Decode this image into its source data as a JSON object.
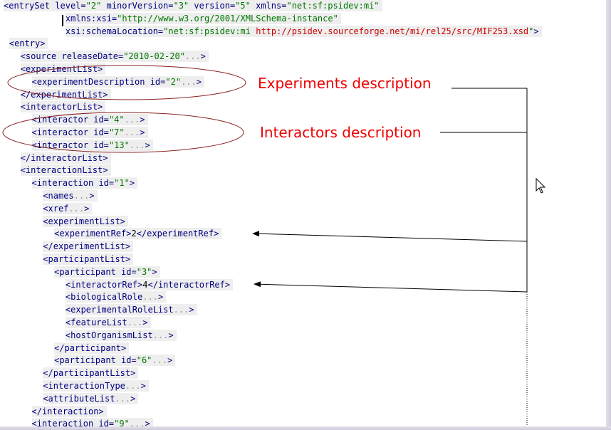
{
  "code_lines": [
    {
      "indent": 0,
      "shaded": true,
      "tokens": [
        {
          "k": "t",
          "s": "<entrySet"
        },
        {
          "k": "x",
          "s": " "
        },
        {
          "k": "a",
          "s": "level="
        },
        {
          "k": "v",
          "s": "\"2\""
        },
        {
          "k": "x",
          "s": " "
        },
        {
          "k": "a",
          "s": "minorVersion="
        },
        {
          "k": "v",
          "s": "\"3\""
        },
        {
          "k": "x",
          "s": " "
        },
        {
          "k": "a",
          "s": "version="
        },
        {
          "k": "v",
          "s": "\"5\""
        },
        {
          "k": "x",
          "s": " "
        },
        {
          "k": "a",
          "s": "xmlns="
        },
        {
          "k": "v",
          "s": "\"net:sf:psidev:mi\""
        }
      ]
    },
    {
      "indent": 11,
      "shaded": true,
      "tokens": [
        {
          "k": "a",
          "s": "xmlns:xsi="
        },
        {
          "k": "v",
          "s": "\"http://www.w3.org/2001/XMLSchema-instance\""
        }
      ]
    },
    {
      "indent": 11,
      "shaded": true,
      "tokens": [
        {
          "k": "a",
          "s": "xsi:schemaLocation="
        },
        {
          "k": "v",
          "s": "\"net:sf:psidev:mi"
        },
        {
          "k": "x",
          "s": " "
        },
        {
          "k": "l",
          "s": "http://psidev.sourceforge.net/mi/rel25/src/MIF253.xsd"
        },
        {
          "k": "v",
          "s": "\""
        },
        {
          "k": "t",
          "s": ">"
        }
      ]
    },
    {
      "indent": 1,
      "shaded": true,
      "tokens": [
        {
          "k": "t",
          "s": "<entry>"
        }
      ]
    },
    {
      "indent": 3,
      "shaded": true,
      "tokens": [
        {
          "k": "t",
          "s": "<source"
        },
        {
          "k": "x",
          "s": " "
        },
        {
          "k": "a",
          "s": "releaseDate="
        },
        {
          "k": "v",
          "s": "\"2010-02-20\""
        },
        {
          "k": "d",
          "s": "..."
        },
        {
          "k": "t",
          "s": ">"
        }
      ]
    },
    {
      "indent": 3,
      "shaded": true,
      "tokens": [
        {
          "k": "t",
          "s": "<experimentList>"
        }
      ]
    },
    {
      "indent": 5,
      "shaded": true,
      "tokens": [
        {
          "k": "t",
          "s": "<experimentDescription"
        },
        {
          "k": "x",
          "s": " "
        },
        {
          "k": "a",
          "s": "id="
        },
        {
          "k": "v",
          "s": "\"2\""
        },
        {
          "k": "d",
          "s": "..."
        },
        {
          "k": "t",
          "s": ">"
        }
      ]
    },
    {
      "indent": 3,
      "shaded": true,
      "tokens": [
        {
          "k": "t",
          "s": "</experimentList>"
        }
      ]
    },
    {
      "indent": 3,
      "shaded": true,
      "tokens": [
        {
          "k": "t",
          "s": "<interactorList>"
        }
      ]
    },
    {
      "indent": 5,
      "shaded": true,
      "tokens": [
        {
          "k": "t",
          "s": "<interactor"
        },
        {
          "k": "x",
          "s": " "
        },
        {
          "k": "a",
          "s": "id="
        },
        {
          "k": "v",
          "s": "\"4\""
        },
        {
          "k": "d",
          "s": "..."
        },
        {
          "k": "t",
          "s": ">"
        }
      ]
    },
    {
      "indent": 5,
      "shaded": true,
      "tokens": [
        {
          "k": "t",
          "s": "<interactor"
        },
        {
          "k": "x",
          "s": " "
        },
        {
          "k": "a",
          "s": "id="
        },
        {
          "k": "v",
          "s": "\"7\""
        },
        {
          "k": "d",
          "s": "..."
        },
        {
          "k": "t",
          "s": ">"
        }
      ]
    },
    {
      "indent": 5,
      "shaded": true,
      "tokens": [
        {
          "k": "t",
          "s": "<interactor"
        },
        {
          "k": "x",
          "s": " "
        },
        {
          "k": "a",
          "s": "id="
        },
        {
          "k": "v",
          "s": "\"13\""
        },
        {
          "k": "d",
          "s": "..."
        },
        {
          "k": "t",
          "s": ">"
        }
      ]
    },
    {
      "indent": 3,
      "shaded": true,
      "tokens": [
        {
          "k": "t",
          "s": "</interactorList>"
        }
      ]
    },
    {
      "indent": 3,
      "shaded": true,
      "tokens": [
        {
          "k": "t",
          "s": "<interactionList>"
        }
      ]
    },
    {
      "indent": 5,
      "shaded": true,
      "tokens": [
        {
          "k": "t",
          "s": "<interaction"
        },
        {
          "k": "x",
          "s": " "
        },
        {
          "k": "a",
          "s": "id="
        },
        {
          "k": "v",
          "s": "\"1\""
        },
        {
          "k": "t",
          "s": ">"
        }
      ]
    },
    {
      "indent": 7,
      "shaded": true,
      "tokens": [
        {
          "k": "t",
          "s": "<names"
        },
        {
          "k": "d",
          "s": "..."
        },
        {
          "k": "t",
          "s": ">"
        }
      ]
    },
    {
      "indent": 7,
      "shaded": true,
      "tokens": [
        {
          "k": "t",
          "s": "<xref"
        },
        {
          "k": "d",
          "s": "..."
        },
        {
          "k": "t",
          "s": ">"
        }
      ]
    },
    {
      "indent": 7,
      "shaded": true,
      "tokens": [
        {
          "k": "t",
          "s": "<experimentList>"
        }
      ]
    },
    {
      "indent": 9,
      "shaded": true,
      "tokens": [
        {
          "k": "t",
          "s": "<experimentRef>"
        },
        {
          "k": "x",
          "s": "2"
        },
        {
          "k": "t",
          "s": "</experimentRef>"
        }
      ]
    },
    {
      "indent": 7,
      "shaded": true,
      "tokens": [
        {
          "k": "t",
          "s": "</experimentList>"
        }
      ]
    },
    {
      "indent": 7,
      "shaded": true,
      "tokens": [
        {
          "k": "t",
          "s": "<participantList>"
        }
      ]
    },
    {
      "indent": 9,
      "shaded": true,
      "tokens": [
        {
          "k": "t",
          "s": "<participant"
        },
        {
          "k": "x",
          "s": " "
        },
        {
          "k": "a",
          "s": "id="
        },
        {
          "k": "v",
          "s": "\"3\""
        },
        {
          "k": "t",
          "s": ">"
        }
      ]
    },
    {
      "indent": 11,
      "shaded": true,
      "tokens": [
        {
          "k": "t",
          "s": "<interactorRef>"
        },
        {
          "k": "x",
          "s": "4"
        },
        {
          "k": "t",
          "s": "</interactorRef>"
        }
      ]
    },
    {
      "indent": 11,
      "shaded": true,
      "tokens": [
        {
          "k": "t",
          "s": "<biologicalRole"
        },
        {
          "k": "d",
          "s": "..."
        },
        {
          "k": "t",
          "s": ">"
        }
      ]
    },
    {
      "indent": 11,
      "shaded": true,
      "tokens": [
        {
          "k": "t",
          "s": "<experimentalRoleList"
        },
        {
          "k": "d",
          "s": "..."
        },
        {
          "k": "t",
          "s": ">"
        }
      ]
    },
    {
      "indent": 11,
      "shaded": true,
      "tokens": [
        {
          "k": "t",
          "s": "<featureList"
        },
        {
          "k": "d",
          "s": "..."
        },
        {
          "k": "t",
          "s": ">"
        }
      ]
    },
    {
      "indent": 11,
      "shaded": true,
      "tokens": [
        {
          "k": "t",
          "s": "<hostOrganismList"
        },
        {
          "k": "d",
          "s": "..."
        },
        {
          "k": "t",
          "s": ">"
        }
      ]
    },
    {
      "indent": 9,
      "shaded": true,
      "tokens": [
        {
          "k": "t",
          "s": "</participant>"
        }
      ]
    },
    {
      "indent": 9,
      "shaded": true,
      "tokens": [
        {
          "k": "t",
          "s": "<participant"
        },
        {
          "k": "x",
          "s": " "
        },
        {
          "k": "a",
          "s": "id="
        },
        {
          "k": "v",
          "s": "\"6\""
        },
        {
          "k": "d",
          "s": "..."
        },
        {
          "k": "t",
          "s": ">"
        }
      ]
    },
    {
      "indent": 7,
      "shaded": true,
      "tokens": [
        {
          "k": "t",
          "s": "</participantList>"
        }
      ]
    },
    {
      "indent": 7,
      "shaded": true,
      "tokens": [
        {
          "k": "t",
          "s": "<interactionType"
        },
        {
          "k": "d",
          "s": "..."
        },
        {
          "k": "t",
          "s": ">"
        }
      ]
    },
    {
      "indent": 7,
      "shaded": true,
      "tokens": [
        {
          "k": "t",
          "s": "<attributeList"
        },
        {
          "k": "d",
          "s": "..."
        },
        {
          "k": "t",
          "s": ">"
        }
      ]
    },
    {
      "indent": 5,
      "shaded": true,
      "tokens": [
        {
          "k": "t",
          "s": "</interaction>"
        }
      ]
    },
    {
      "indent": 5,
      "shaded": true,
      "tokens": [
        {
          "k": "t",
          "s": "<interaction"
        },
        {
          "k": "x",
          "s": " "
        },
        {
          "k": "a",
          "s": "id="
        },
        {
          "k": "v",
          "s": "\"9\""
        },
        {
          "k": "d",
          "s": "..."
        },
        {
          "k": "t",
          "s": ">"
        }
      ]
    }
  ],
  "annotations": {
    "experiments": "Experiments description",
    "interactors": "Interactors description"
  },
  "colors": {
    "tag": "#000080",
    "attr_value": "#007700",
    "link": "#cc0000",
    "ellipse": "#882222",
    "annotation": "#ee0000",
    "connector": "#000000"
  }
}
